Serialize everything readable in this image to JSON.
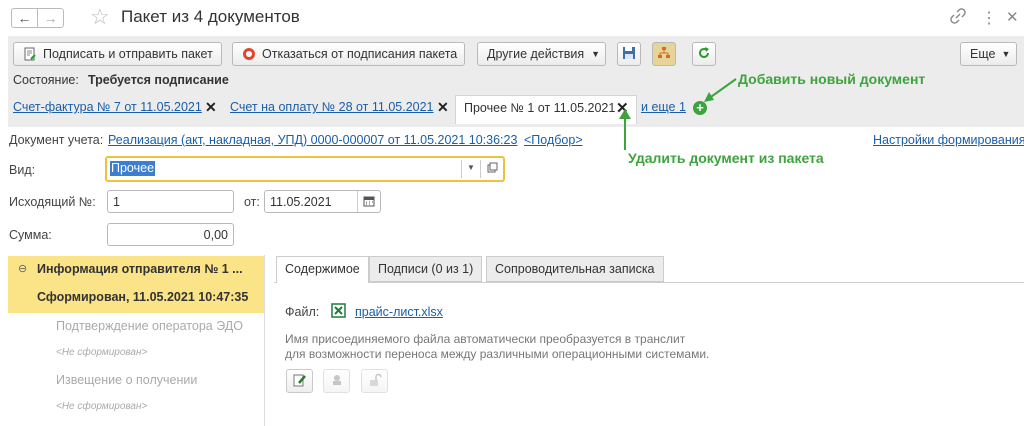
{
  "window": {
    "title": "Пакет из 4 документов"
  },
  "toolbar": {
    "sign_send": "Подписать и отправить пакет",
    "refuse_sign": "Отказаться от подписания пакета",
    "other_actions": "Другие действия",
    "more": "Еще"
  },
  "status": {
    "label": "Состояние:",
    "value": "Требуется подписание"
  },
  "doc_tabs": {
    "tab1": "Счет-фактура № 7 от 11.05.2021",
    "tab2": "Счет на оплату № 28 от 11.05.2021",
    "tab3": "Прочее № 1 от 11.05.2021",
    "more": "и еще 1"
  },
  "annotations": {
    "add": "Добавить новый документ",
    "remove": "Удалить документ из пакета"
  },
  "form": {
    "doc_label": "Документ учета:",
    "doc_link": "Реализация (акт, накладная, УПД) 0000-000007 от 11.05.2021 10:36:23",
    "pick_link": "<Подбор>",
    "settings_link": "Настройки формирования",
    "vid_label": "Вид:",
    "vid_value": "Прочее",
    "out_no_label": "Исходящий №:",
    "out_no_value": "1",
    "date_label": "от:",
    "date_value": "11.05.2021",
    "sum_label": "Сумма:",
    "sum_value": "0,00"
  },
  "left_panel": {
    "item1": "Информация отправителя № 1 ...",
    "item1_sub": "Сформирован, 11.05.2021 10:47:35",
    "item2": "Подтверждение оператора ЭДО",
    "item2_sub": "<Не сформирован>",
    "item3": "Извещение о получении",
    "item3_sub": "<Не сформирован>"
  },
  "right_tabs": {
    "content": "Содержимое",
    "signatures": "Подписи (0 из 1)",
    "note": "Сопроводительная записка"
  },
  "content": {
    "file_label": "Файл:",
    "file_name": "прайс-лист.xlsx",
    "hint_line1": "Имя присоединяемого файла автоматически преобразуется в транслит",
    "hint_line2": "для возможности переноса между различными операционными системами."
  },
  "colors": {
    "accent_yellow": "#fbe388",
    "annotation_green": "#3ea33e",
    "link_blue": "#1a5ea8"
  }
}
